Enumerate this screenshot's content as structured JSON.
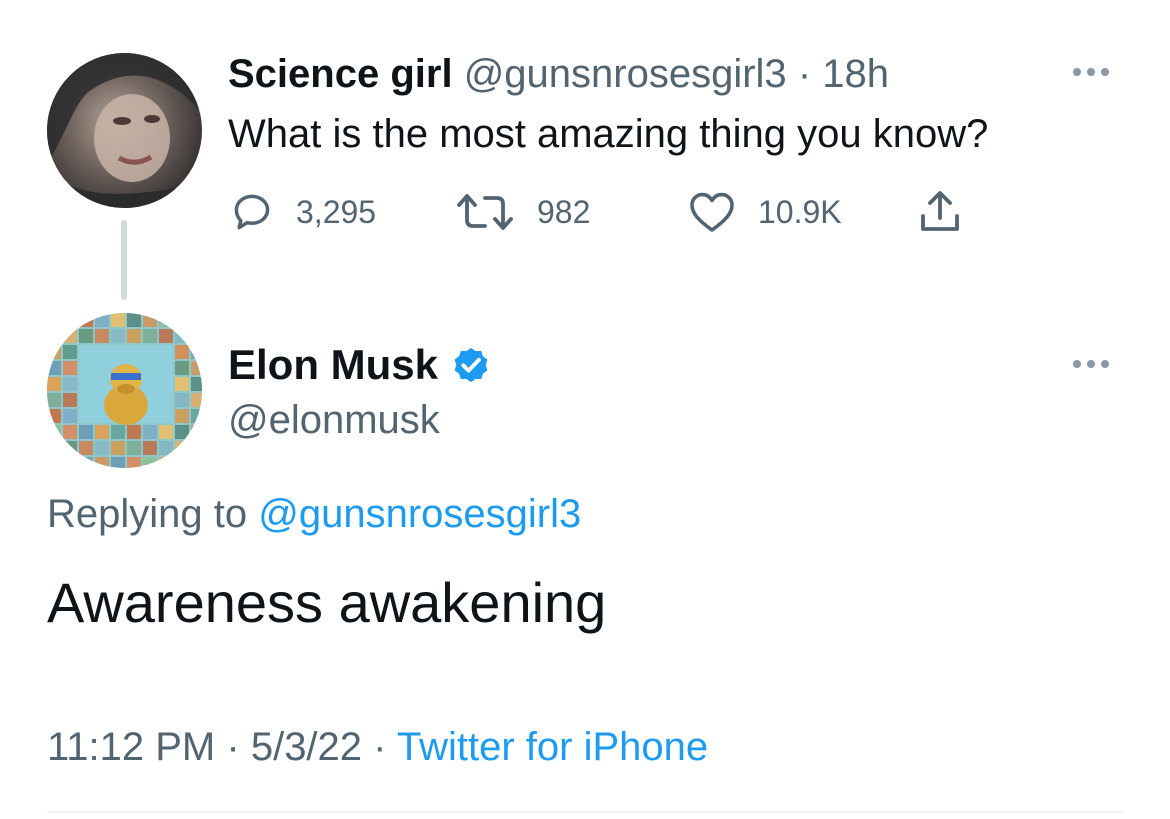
{
  "parent_tweet": {
    "name": "Science girl",
    "handle": "@gunsnrosesgirl3",
    "separator": "·",
    "time": "18h",
    "text": "What is the most amazing thing you know?",
    "actions": {
      "replies": "3,295",
      "retweets": "982",
      "likes": "10.9K"
    },
    "icons": [
      "reply-icon",
      "retweet-icon",
      "like-icon",
      "share-icon",
      "more-icon"
    ]
  },
  "reply_tweet": {
    "name": "Elon Musk",
    "verified": true,
    "handle": "@elonmusk",
    "replying_prefix": "Replying to",
    "replying_to": "@gunsnrosesgirl3",
    "text": "Awareness awakening",
    "time": "11:12 PM",
    "date": "5/3/22",
    "separator": "·",
    "client": "Twitter for iPhone"
  },
  "colors": {
    "accent": "#1d9bf0",
    "secondary_text": "#536471",
    "primary_text": "#0f1419",
    "thread_line": "#cfd9de"
  }
}
